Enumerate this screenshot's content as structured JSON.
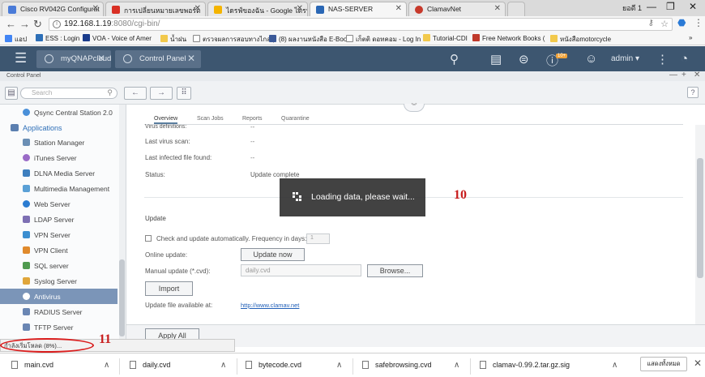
{
  "browser": {
    "tabs": [
      {
        "title": "Cisco RV042G Configurat",
        "icon_color": "#4a7bd8"
      },
      {
        "title": "การเปลี่ยนหมายเลขพอร์ต",
        "icon_color": "#d93025"
      },
      {
        "title": "ไดรฟ์ของฉัน - Google ไดรฟ์",
        "icon_color": "#f4b400"
      },
      {
        "title": "NAS-SERVER",
        "icon_color": "#2a67b5"
      },
      {
        "title": "ClamavNet",
        "icon_color": "#c7392b"
      }
    ],
    "profile_name": "ยอดี 1",
    "url_host": "192.168.1.19",
    "url_port": ":8080",
    "url_path": "/cgi-bin/",
    "bookmarks": [
      {
        "label": "แอป",
        "icon_color": "#4285f4"
      },
      {
        "label": "ESS : Login",
        "icon_color": "#2d6fb7"
      },
      {
        "label": "VOA - Voice of Amer",
        "icon_color": "#1a3c8c"
      },
      {
        "label": "น้ำฝน",
        "icon_color": "#f2c94c"
      },
      {
        "label": "ตรวจผลการสอบทางไกลๆ",
        "icon_color": "#888888"
      },
      {
        "label": "(8) ผลงานหนังสือ E-Book",
        "icon_color": "#3b5998"
      },
      {
        "label": "เก็ตติ ดอทคอม - Log In",
        "icon_color": "#888888"
      },
      {
        "label": "Tutorial-CDI",
        "icon_color": "#f2c94c"
      },
      {
        "label": "Free Network Books (",
        "icon_color": "#c0392b"
      },
      {
        "label": "หนังสือmotorcycle",
        "icon_color": "#f2c94c"
      }
    ],
    "more_bookmarks": "»"
  },
  "qnap": {
    "tabs": [
      {
        "label": "myQNAPcloud"
      },
      {
        "label": "Control Panel"
      }
    ],
    "badge": "10+",
    "user": "admin ▾"
  },
  "control_panel": {
    "title": "Control Panel",
    "search_placeholder": "Search",
    "help_label": "?"
  },
  "sidebar": {
    "items": [
      {
        "label": "Qsync Central Station 2.0",
        "type": "item",
        "icon_color": "#4a90d9"
      },
      {
        "label": "Applications",
        "type": "group"
      },
      {
        "label": "Station Manager",
        "type": "item",
        "icon_color": "#6b8fb5"
      },
      {
        "label": "iTunes Server",
        "type": "item",
        "icon_color": "#9a6bc7"
      },
      {
        "label": "DLNA Media Server",
        "type": "item",
        "icon_color": "#3e7fbf"
      },
      {
        "label": "Multimedia Management",
        "type": "item",
        "icon_color": "#5aa0d6"
      },
      {
        "label": "Web Server",
        "type": "item",
        "icon_color": "#2b7cd1"
      },
      {
        "label": "LDAP Server",
        "type": "item",
        "icon_color": "#7d6fb3"
      },
      {
        "label": "VPN Server",
        "type": "item",
        "icon_color": "#3b8ed0"
      },
      {
        "label": "VPN Client",
        "type": "item",
        "icon_color": "#e08a2c"
      },
      {
        "label": "SQL server",
        "type": "item",
        "icon_color": "#4f9a4f"
      },
      {
        "label": "Syslog Server",
        "type": "item",
        "icon_color": "#e0a63a"
      },
      {
        "label": "Antivirus",
        "type": "item",
        "active": true,
        "icon_color": "#ffffff"
      },
      {
        "label": "RADIUS Server",
        "type": "item",
        "icon_color": "#6a86b3"
      },
      {
        "label": "TFTP Server",
        "type": "item",
        "icon_color": "#6a86b3"
      }
    ]
  },
  "subtabs": [
    {
      "label": "Overview",
      "active": true
    },
    {
      "label": "Scan Jobs"
    },
    {
      "label": "Reports"
    },
    {
      "label": "Quarantine"
    }
  ],
  "overview": {
    "virus_def_label": "Virus definitions:",
    "virus_def_value": "--",
    "last_scan_label": "Last virus scan:",
    "last_scan_value": "--",
    "last_infected_label": "Last infected file found:",
    "last_infected_value": "--",
    "status_label": "Status:",
    "status_value": "Update complete"
  },
  "update": {
    "heading": "Update",
    "auto_label": "Check and update automatically. Frequency in days:",
    "auto_days": "1",
    "online_label": "Online update:",
    "online_button": "Update now",
    "manual_label": "Manual update (*.cvd):",
    "manual_value": "daily.cvd",
    "browse_button": "Browse...",
    "import_button": "Import",
    "available_label": "Update file available at:",
    "available_link": "http://www.clamav.net",
    "apply_all_button": "Apply All"
  },
  "loading": {
    "text": "Loading data, please wait..."
  },
  "annotations": {
    "loading_marker": "10",
    "status_marker": "11"
  },
  "status_bubble": {
    "text": "กำลังเริ่มโหลด (8%)..."
  },
  "downloads": {
    "items": [
      {
        "name": "main.cvd"
      },
      {
        "name": "daily.cvd"
      },
      {
        "name": "bytecode.cvd"
      },
      {
        "name": "safebrowsing.cvd"
      },
      {
        "name": "clamav-0.99.2.tar.gz.sig"
      }
    ],
    "show_all": "แสดงทั้งหมด"
  }
}
